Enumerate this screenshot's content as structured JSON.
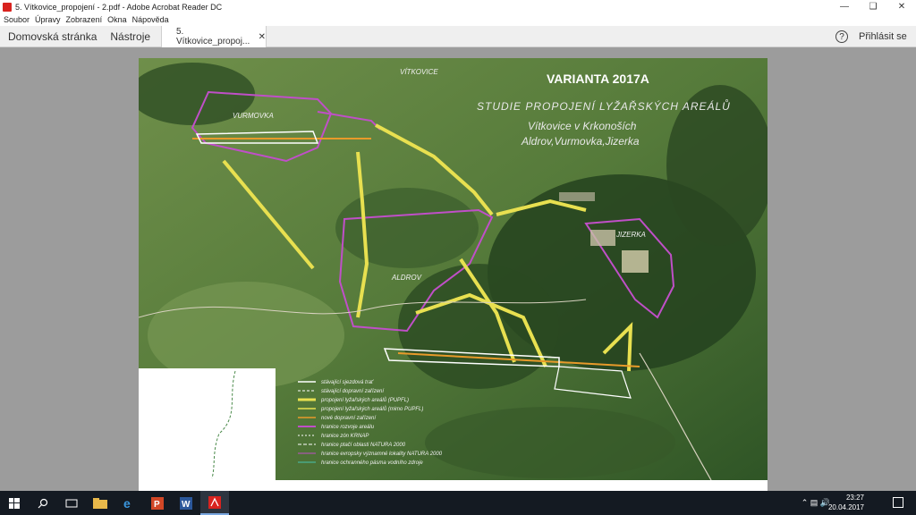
{
  "window": {
    "title": "5. Vítkovice_propojení - 2.pdf - Adobe Acrobat Reader DC"
  },
  "menu": [
    "Soubor",
    "Úpravy",
    "Zobrazení",
    "Okna",
    "Nápověda"
  ],
  "toolbar": {
    "home": "Domovská stránka",
    "tools": "Nástroje",
    "doc_tab": "5. Vítkovice_propoj...",
    "signin": "Přihlásit se",
    "help": "?"
  },
  "map": {
    "title": "VARIANTA 2017A",
    "subtitle_lines": [
      "STUDIE PROPOJENÍ LYŽAŘSKÝCH AREÁLŮ",
      "Vítkovice v Krkonoších",
      "Aldrov,Vurmovka,Jizerka"
    ],
    "places": [
      "VÍTKOVICE",
      "VURMOVKA",
      "JIZERKA",
      "ALDROV"
    ],
    "legend": [
      "stávající sjezdová trať",
      "stávající dopravní zařízení",
      "propojení lyžařských areálů (PUPFL)",
      "propojení lyžařských areálů (mimo PUPFL)",
      "nové dopravní zařízení",
      "hranice rozvoje areálu",
      "hranice zón KRNAP",
      "hranice ptačí oblasti NATURA 2000",
      "hranice evropsky významné lokality NATURA 2000",
      "hranice ochranného pásma vodního zdroje"
    ],
    "colors": {
      "pistes": "#e8e050",
      "boundary": "#c04fc8",
      "lift_new": "#e89a2a"
    }
  },
  "taskbar": {
    "time": "23:27",
    "date": "20.04.2017"
  }
}
